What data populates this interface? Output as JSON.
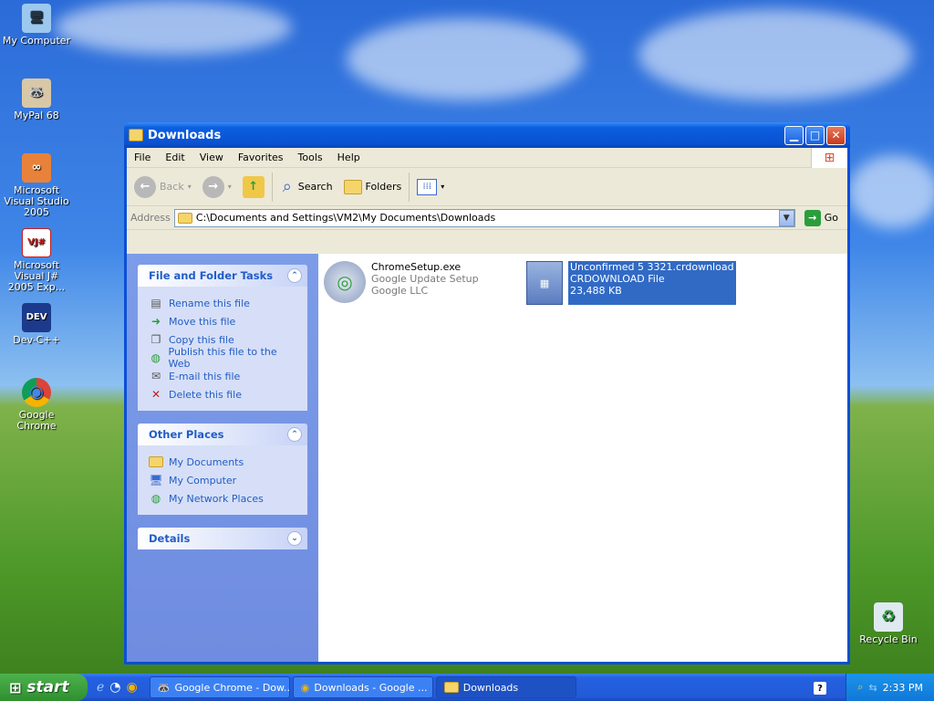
{
  "desktop_icons": [
    {
      "label": "My Computer",
      "glyph": "🖥"
    },
    {
      "label": "MyPal 68",
      "glyph": "🦝"
    },
    {
      "label": "Microsoft Visual Studio 2005",
      "glyph": "∞"
    },
    {
      "label": "Microsoft Visual J# 2005 Exp...",
      "glyph": "VJ#"
    },
    {
      "label": "Dev-C++",
      "glyph": "DEV"
    },
    {
      "label": "Google Chrome",
      "glyph": "◉"
    },
    {
      "label": "Recycle Bin",
      "glyph": "♻"
    }
  ],
  "window": {
    "title": "Downloads"
  },
  "menu": [
    "File",
    "Edit",
    "View",
    "Favorites",
    "Tools",
    "Help"
  ],
  "toolbar": {
    "back": "Back",
    "search": "Search",
    "folders": "Folders"
  },
  "address": {
    "label": "Address",
    "value": "C:\\Documents and Settings\\VM2\\My Documents\\Downloads",
    "go": "Go"
  },
  "tasks_panel": {
    "title": "File and Folder Tasks",
    "items": [
      "Rename this file",
      "Move this file",
      "Copy this file",
      "Publish this file to the Web",
      "E-mail this file",
      "Delete this file"
    ]
  },
  "places_panel": {
    "title": "Other Places",
    "items": [
      "My Documents",
      "My Computer",
      "My Network Places"
    ]
  },
  "details_panel": {
    "title": "Details"
  },
  "files": [
    {
      "name": "ChromeSetup.exe",
      "line2": "Google Update Setup",
      "line3": "Google LLC"
    },
    {
      "name": "Unconfirmed 5 3321.crdownload",
      "line2": "CRDOWNLOAD File",
      "line3": "23,488 KB"
    }
  ],
  "taskbar": {
    "start": "start",
    "tasks": [
      "Google Chrome - Dow...",
      "Downloads - Google ...",
      "Downloads"
    ],
    "time": "2:33 PM"
  }
}
